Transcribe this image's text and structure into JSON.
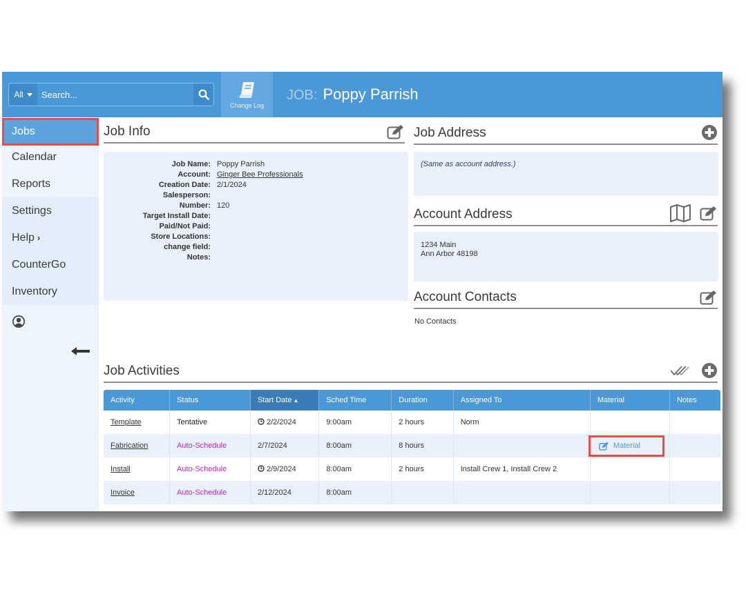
{
  "topbar": {
    "search_scope": "All",
    "search_placeholder": "Search...",
    "change_log_label": "Change Log",
    "title_prefix": "JOB:",
    "title": "Poppy Parrish"
  },
  "sidebar": {
    "items": [
      {
        "label": "Jobs"
      },
      {
        "label": "Calendar"
      },
      {
        "label": "Reports"
      },
      {
        "label": "Settings"
      },
      {
        "label": "Help"
      },
      {
        "label": "CounterGo"
      },
      {
        "label": "Inventory"
      }
    ]
  },
  "job_info": {
    "title": "Job Info",
    "fields": [
      {
        "label": "Job Name:",
        "value": "Poppy Parrish"
      },
      {
        "label": "Account:",
        "value": "Ginger Bee Professionals"
      },
      {
        "label": "Creation Date:",
        "value": "2/1/2024"
      },
      {
        "label": "Salesperson:",
        "value": ""
      },
      {
        "label": "Number:",
        "value": "120"
      },
      {
        "label": "Target Install Date:",
        "value": ""
      },
      {
        "label": "Paid/Not Paid:",
        "value": ""
      },
      {
        "label": "Store Locations:",
        "value": ""
      },
      {
        "label": "change field:",
        "value": ""
      },
      {
        "label": "Notes:",
        "value": ""
      }
    ]
  },
  "job_address": {
    "title": "Job Address",
    "note": "(Same as account address.)"
  },
  "account_address": {
    "title": "Account Address",
    "line1": "1234 Main",
    "line2": "Ann Arbor 48198"
  },
  "account_contacts": {
    "title": "Account Contacts",
    "empty_text": "No Contacts"
  },
  "activities": {
    "title": "Job Activities",
    "columns": [
      "Activity",
      "Status",
      "Start Date",
      "Sched Time",
      "Duration",
      "Assigned To",
      "Material",
      "Notes"
    ],
    "sort_indicator": "▲",
    "rows": [
      {
        "activity": "Template",
        "status": "Tentative",
        "start": "2/2/2024",
        "clock": true,
        "time": "9:00am",
        "duration": "2 hours",
        "assigned": "Norm",
        "material": "",
        "notes": ""
      },
      {
        "activity": "Fabrication",
        "status": "Auto-Schedule",
        "start": "2/7/2024",
        "clock": false,
        "time": "8:00am",
        "duration": "8 hours",
        "assigned": "",
        "material": "Material",
        "notes": ""
      },
      {
        "activity": "Install",
        "status": "Auto-Schedule",
        "start": "2/9/2024",
        "clock": true,
        "time": "8:00am",
        "duration": "2 hours",
        "assigned": "Install Crew 1, Install Crew 2",
        "material": "",
        "notes": ""
      },
      {
        "activity": "Invoice",
        "status": "Auto-Schedule",
        "start": "2/12/2024",
        "clock": false,
        "time": "8:00am",
        "duration": "",
        "assigned": "",
        "material": "",
        "notes": ""
      }
    ]
  },
  "colors": {
    "brand_blue": "#4a98d6",
    "highlight_red": "#ec4b45",
    "auto_schedule": "#b12db5"
  }
}
